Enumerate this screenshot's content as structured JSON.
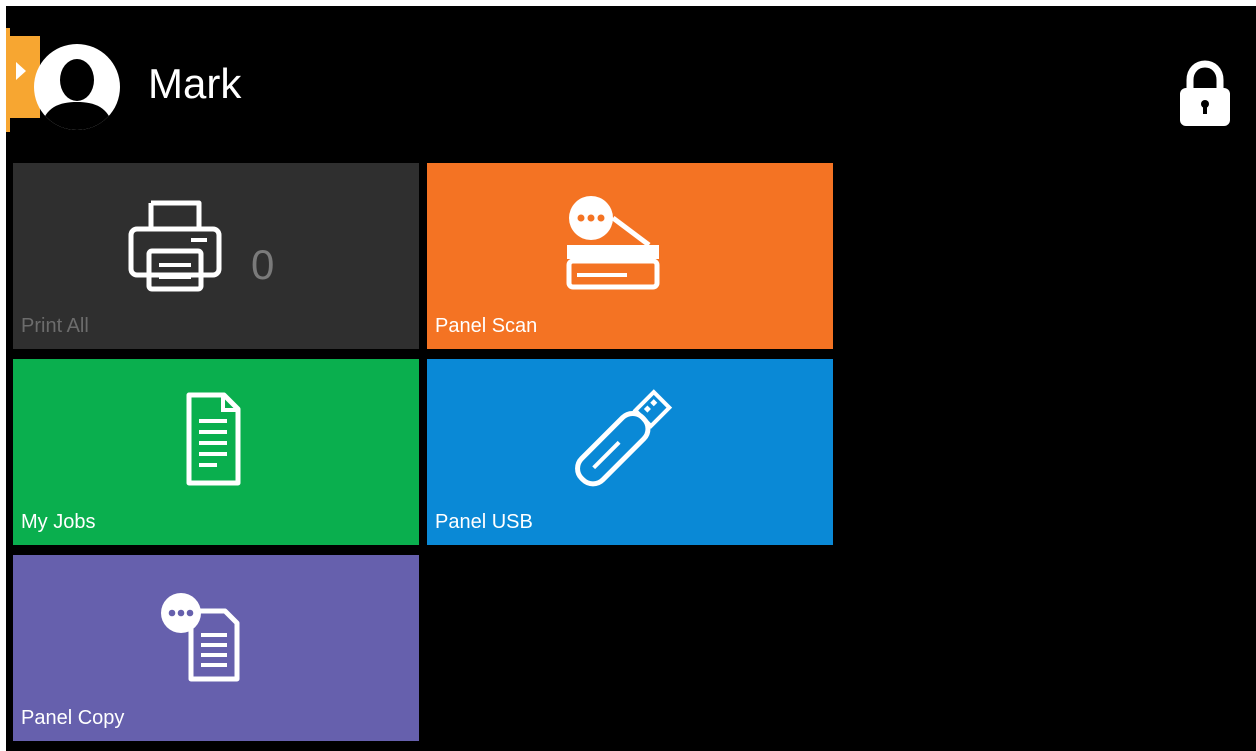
{
  "header": {
    "user_name": "Mark",
    "drawer_icon": "chevron-right-icon",
    "avatar_icon": "user-avatar-icon",
    "lock_icon": "lock-icon"
  },
  "tiles": [
    {
      "label": "Print All",
      "icon": "printer-icon",
      "count": "0",
      "color": "#2f2f2f"
    },
    {
      "label": "Panel Scan",
      "icon": "scanner-icon",
      "color": "#f47323"
    },
    {
      "label": "My Jobs",
      "icon": "document-icon",
      "color": "#0aaf4e"
    },
    {
      "label": "Panel USB",
      "icon": "usb-drive-icon",
      "color": "#0a89d6"
    },
    {
      "label": "Panel Copy",
      "icon": "copy-documents-icon",
      "color": "#6660ad"
    }
  ],
  "colors": {
    "background": "#000000",
    "accent": "#f7a631"
  }
}
